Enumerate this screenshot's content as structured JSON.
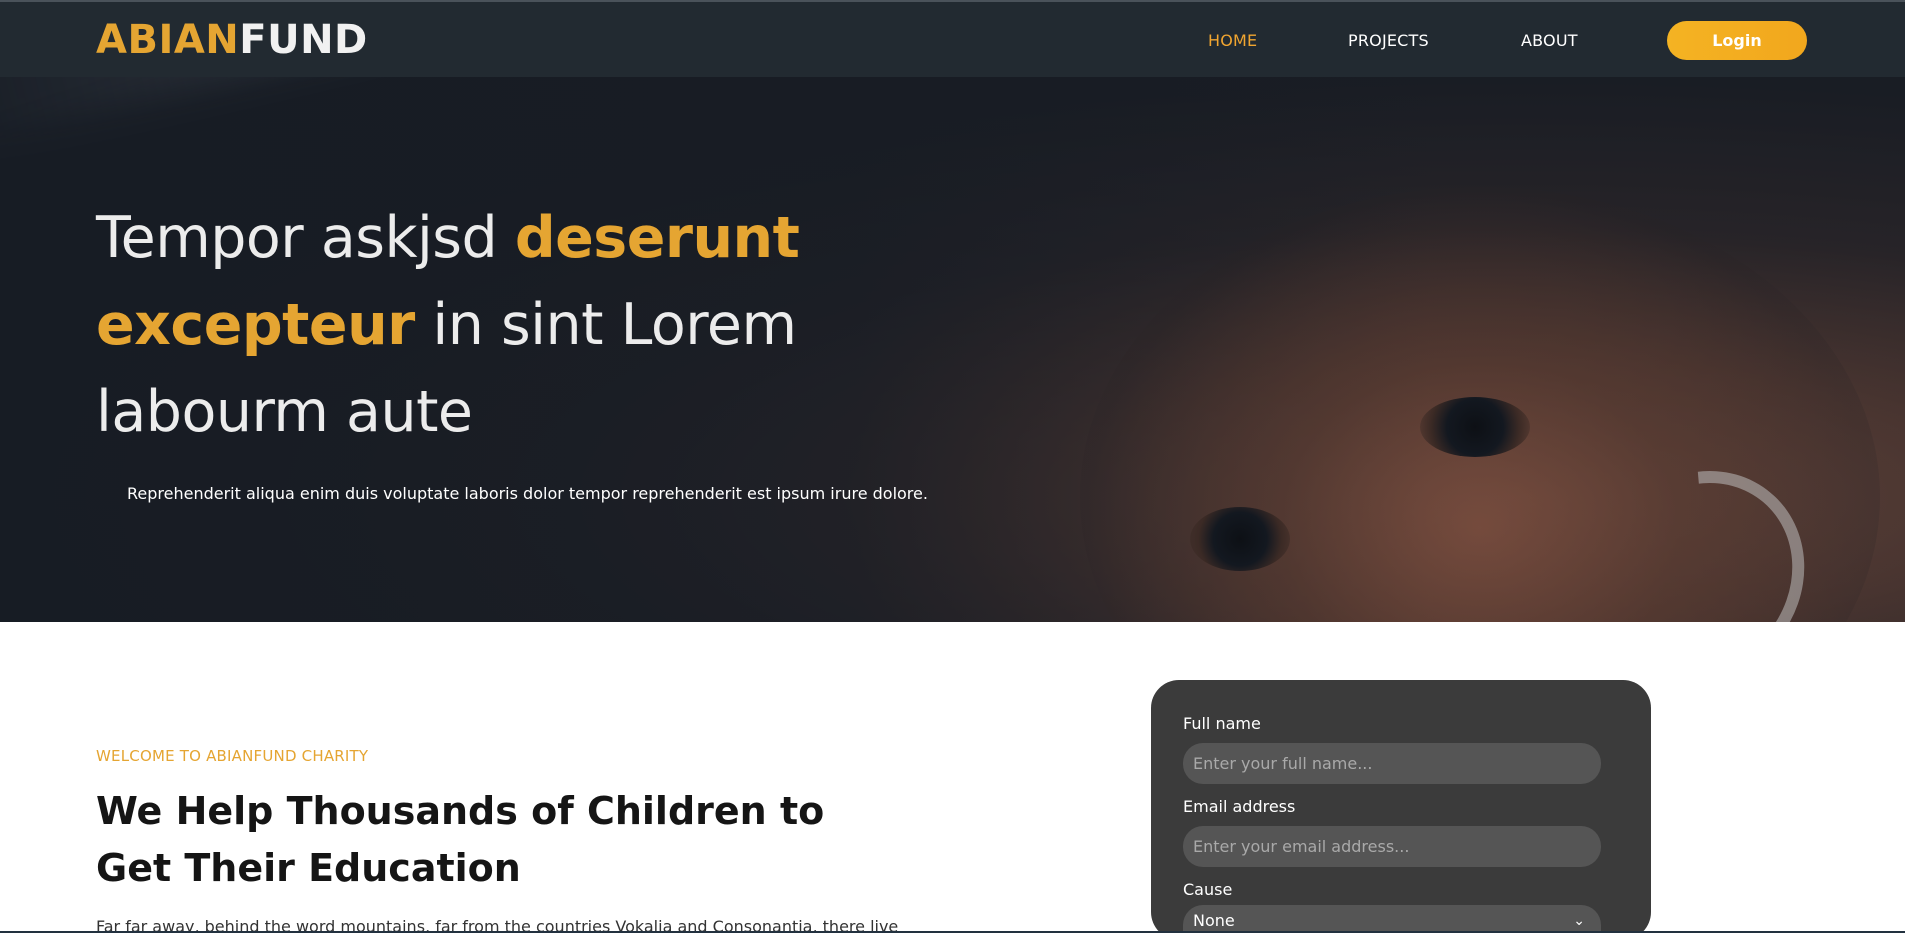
{
  "brand": {
    "part1": "ABIAN",
    "part2": "FUND",
    "color1": "#e5a532",
    "color2": "#f1f1f1"
  },
  "nav": {
    "items": [
      {
        "label": "HOME",
        "active": true
      },
      {
        "label": "PROJECTS",
        "active": false
      },
      {
        "label": "ABOUT",
        "active": false
      }
    ],
    "login_label": "Login"
  },
  "hero": {
    "title_part1": "Tempor askjsd ",
    "title_highlight": "deserunt excepteur",
    "title_part2": " in sint Lorem labourm aute",
    "subtitle": "Reprehenderit aliqua enim duis voluptate laboris dolor tempor reprehenderit est ipsum irure dolore."
  },
  "intro": {
    "label": "WELCOME TO ABIANFUND CHARITY",
    "title": "We Help Thousands of Children to Get Their Education",
    "text": "Far far away, behind the word mountains, far from the countries Vokalia and Consonantia, there live"
  },
  "form": {
    "name_label": "Full name",
    "name_placeholder": "Enter your full name...",
    "email_label": "Email address",
    "email_placeholder": "Enter your email address...",
    "cause_label": "Cause",
    "cause_value": "None"
  },
  "colors": {
    "accent": "#e5a532",
    "navbar": "#222a31",
    "card": "#3b3b3b"
  }
}
